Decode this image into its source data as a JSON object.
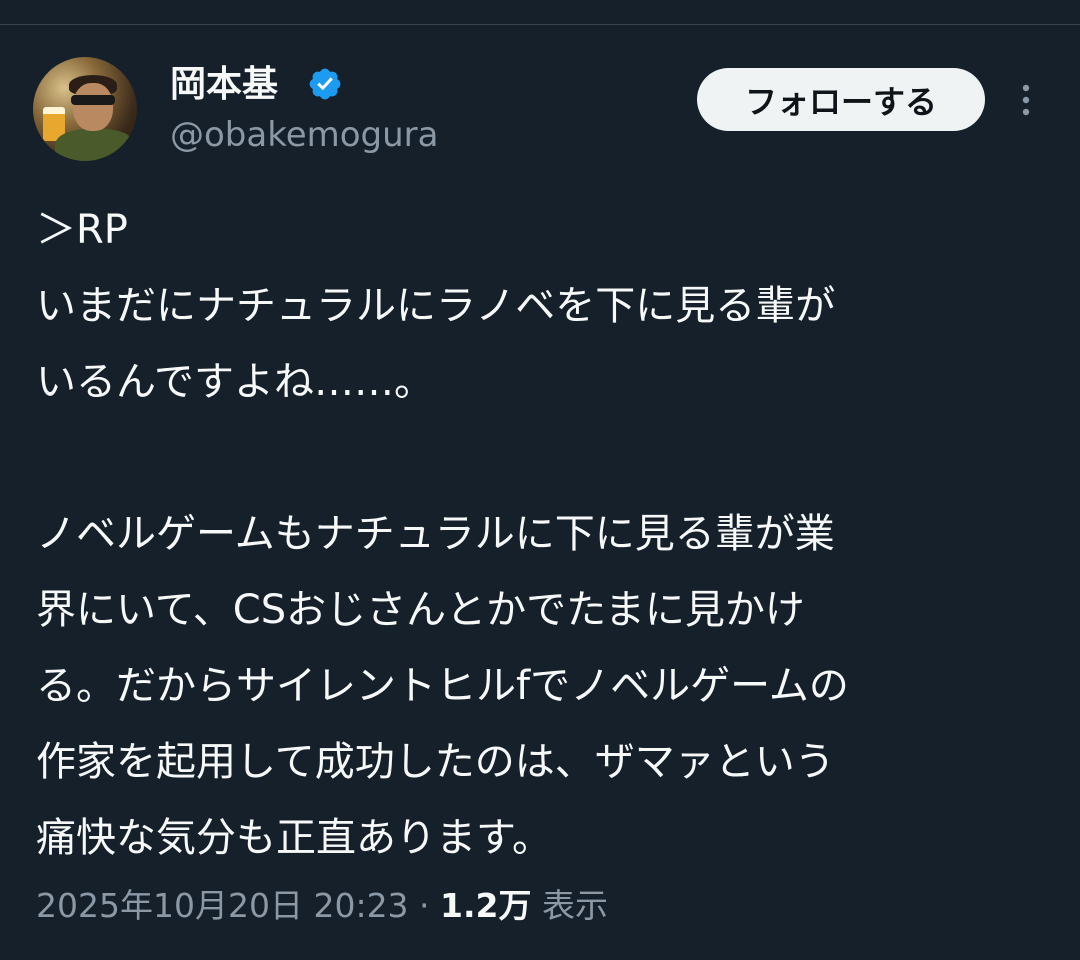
{
  "author": {
    "display_name": "岡本基",
    "handle": "@obakemogura",
    "verified_icon": "verified-badge-icon",
    "verified_color": "#1d9bf0"
  },
  "actions": {
    "follow_label": "フォローする",
    "more_icon": "more-vertical-icon"
  },
  "tweet": {
    "lines": [
      "＞RP",
      "いまだにナチュラルにラノベを下に見る輩が",
      "いるんですよね……。",
      "",
      "ノベルゲームもナチュラルに下に見る輩が業",
      "界にいて、CSおじさんとかでたまに見かけ",
      "る。だからサイレントヒルfでノベルゲームの",
      "作家を起用して成功したのは、ザマァという",
      "痛快な気分も正直あります。"
    ]
  },
  "meta": {
    "timestamp": "2025年10月20日 20:23",
    "separator": " · ",
    "views_count": "1.2万",
    "views_label": " 表示"
  },
  "colors": {
    "background": "#15202b",
    "text": "#f7f9f9",
    "secondary_text": "#8b98a5",
    "button_bg": "#eff3f4"
  }
}
